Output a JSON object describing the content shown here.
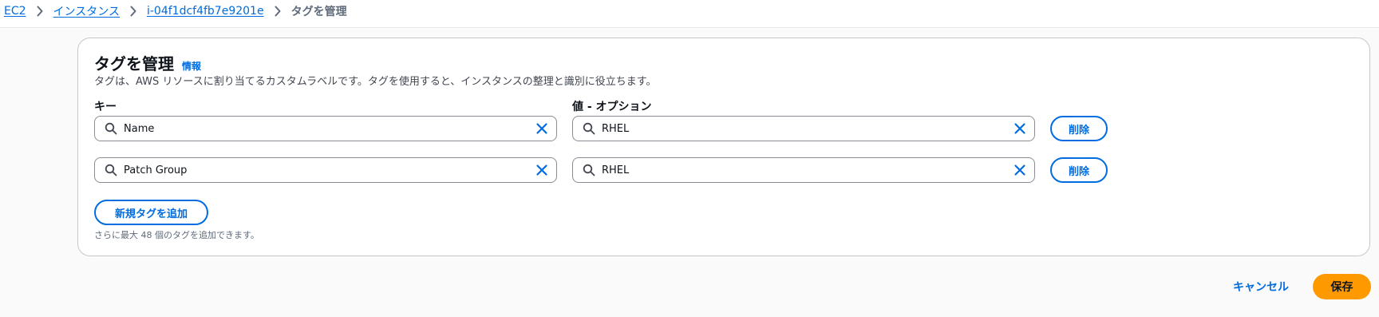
{
  "breadcrumb": {
    "items": [
      "EC2",
      "インスタンス",
      "i-04f1dcf4fb7e9201e"
    ],
    "current": "タグを管理"
  },
  "panel": {
    "title": "タグを管理",
    "info_label": "情報",
    "description": "タグは、AWS リソースに割り当てるカスタムラベルです。タグを使用すると、インスタンスの整理と識別に役立ちます。",
    "key_label": "キー",
    "value_label": "値 - オプション",
    "tags": [
      {
        "key": "Name",
        "value": "RHEL",
        "remove_label": "削除"
      },
      {
        "key": "Patch Group",
        "value": "RHEL",
        "remove_label": "削除"
      }
    ],
    "add_button_label": "新規タグを追加",
    "limit_note": "さらに最大 48 個のタグを追加できます。"
  },
  "footer": {
    "cancel_label": "キャンセル",
    "save_label": "保存"
  },
  "colors": {
    "link": "#006ce0",
    "primary_button": "#ff9900",
    "border": "#8c8c94",
    "background": "#fafafa"
  },
  "icons": {
    "breadcrumb_separator": "chevron-right-icon",
    "field_prefix": "search-icon",
    "field_clear": "close-icon"
  }
}
